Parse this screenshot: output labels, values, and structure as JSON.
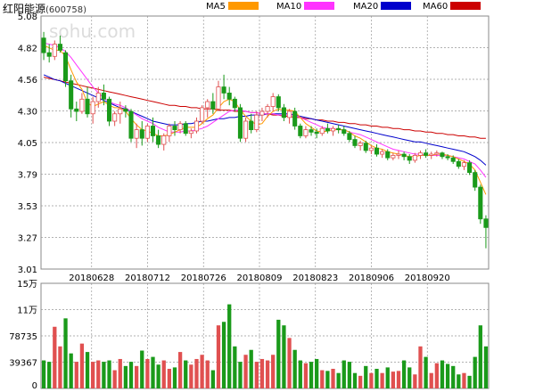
{
  "stock_name": "红阳能源",
  "stock_code": "(600758)",
  "watermark": "sohu.com",
  "legend": [
    {
      "label": "MA5",
      "color": "#ff9900"
    },
    {
      "label": "MA10",
      "color": "#ff33ff"
    },
    {
      "label": "MA20",
      "color": "#0000cc"
    },
    {
      "label": "MA60",
      "color": "#cc0000"
    }
  ],
  "colors": {
    "up": "#e05050",
    "down": "#1a9a1a",
    "grid": "#999999"
  },
  "chart_data": [
    {
      "type": "candlestick",
      "title": "",
      "ylim": [
        3.01,
        5.08
      ],
      "y_ticks": [
        "5.08",
        "4.82",
        "4.56",
        "4.30",
        "4.05",
        "3.79",
        "3.53",
        "3.27",
        "3.01"
      ],
      "x_tick_labels": [
        "20180628",
        "20180712",
        "20180726",
        "20180809",
        "20180823",
        "20180906",
        "20180920"
      ],
      "ohlc": [
        [
          4.9,
          4.95,
          4.72,
          4.78
        ],
        [
          4.78,
          4.85,
          4.7,
          4.75
        ],
        [
          4.75,
          4.88,
          4.72,
          4.85
        ],
        [
          4.85,
          4.92,
          4.78,
          4.8
        ],
        [
          4.78,
          4.8,
          4.5,
          4.55
        ],
        [
          4.55,
          4.6,
          4.25,
          4.32
        ],
        [
          4.32,
          4.38,
          4.22,
          4.3
        ],
        [
          4.3,
          4.45,
          4.28,
          4.4
        ],
        [
          4.4,
          4.5,
          4.25,
          4.28
        ],
        [
          4.28,
          4.42,
          4.2,
          4.38
        ],
        [
          4.38,
          4.5,
          4.33,
          4.45
        ],
        [
          4.45,
          4.52,
          4.35,
          4.4
        ],
        [
          4.4,
          4.42,
          4.18,
          4.22
        ],
        [
          4.22,
          4.3,
          4.18,
          4.28
        ],
        [
          4.28,
          4.38,
          4.2,
          4.32
        ],
        [
          4.32,
          4.35,
          4.25,
          4.3
        ],
        [
          4.3,
          4.32,
          4.05,
          4.08
        ],
        [
          4.08,
          4.2,
          4.0,
          4.15
        ],
        [
          4.15,
          4.22,
          4.02,
          4.08
        ],
        [
          4.08,
          4.2,
          4.05,
          4.18
        ],
        [
          4.18,
          4.25,
          4.05,
          4.1
        ],
        [
          4.1,
          4.15,
          4.0,
          4.03
        ],
        [
          4.03,
          4.12,
          3.98,
          4.1
        ],
        [
          4.1,
          4.2,
          4.05,
          4.18
        ],
        [
          4.18,
          4.22,
          4.1,
          4.15
        ],
        [
          4.15,
          4.22,
          4.12,
          4.2
        ],
        [
          4.2,
          4.22,
          4.1,
          4.12
        ],
        [
          4.12,
          4.16,
          4.08,
          4.14
        ],
        [
          4.14,
          4.25,
          4.12,
          4.22
        ],
        [
          4.22,
          4.35,
          4.2,
          4.33
        ],
        [
          4.33,
          4.4,
          4.25,
          4.38
        ],
        [
          4.38,
          4.45,
          4.28,
          4.32
        ],
        [
          4.32,
          4.55,
          4.3,
          4.5
        ],
        [
          4.5,
          4.6,
          4.4,
          4.45
        ],
        [
          4.45,
          4.5,
          4.35,
          4.4
        ],
        [
          4.4,
          4.42,
          4.3,
          4.33
        ],
        [
          4.33,
          4.36,
          4.05,
          4.08
        ],
        [
          4.08,
          4.25,
          4.05,
          4.22
        ],
        [
          4.22,
          4.28,
          4.12,
          4.15
        ],
        [
          4.15,
          4.3,
          4.13,
          4.27
        ],
        [
          4.27,
          4.33,
          4.22,
          4.3
        ],
        [
          4.3,
          4.36,
          4.25,
          4.34
        ],
        [
          4.34,
          4.45,
          4.3,
          4.42
        ],
        [
          4.42,
          4.44,
          4.3,
          4.33
        ],
        [
          4.33,
          4.36,
          4.22,
          4.25
        ],
        [
          4.25,
          4.32,
          4.2,
          4.3
        ],
        [
          4.3,
          4.33,
          4.15,
          4.18
        ],
        [
          4.18,
          4.2,
          4.08,
          4.1
        ],
        [
          4.1,
          4.18,
          4.08,
          4.15
        ],
        [
          4.15,
          4.18,
          4.1,
          4.13
        ],
        [
          4.13,
          4.16,
          4.08,
          4.12
        ],
        [
          4.12,
          4.18,
          4.1,
          4.16
        ],
        [
          4.16,
          4.2,
          4.12,
          4.14
        ],
        [
          4.14,
          4.18,
          4.1,
          4.16
        ],
        [
          4.16,
          4.19,
          4.12,
          4.15
        ],
        [
          4.15,
          4.18,
          4.1,
          4.12
        ],
        [
          4.12,
          4.14,
          4.05,
          4.07
        ],
        [
          4.07,
          4.1,
          4.0,
          4.02
        ],
        [
          4.02,
          4.06,
          3.98,
          4.04
        ],
        [
          4.04,
          4.06,
          3.96,
          3.98
        ],
        [
          3.98,
          4.02,
          3.95,
          4.0
        ],
        [
          4.0,
          4.03,
          3.93,
          3.95
        ],
        [
          3.95,
          3.99,
          3.92,
          3.97
        ],
        [
          3.97,
          3.99,
          3.9,
          3.92
        ],
        [
          3.92,
          3.96,
          3.9,
          3.94
        ],
        [
          3.94,
          3.98,
          3.91,
          3.95
        ],
        [
          3.95,
          3.97,
          3.9,
          3.93
        ],
        [
          3.93,
          3.95,
          3.87,
          3.9
        ],
        [
          3.9,
          3.96,
          3.88,
          3.94
        ],
        [
          3.94,
          3.98,
          3.91,
          3.96
        ],
        [
          3.96,
          3.99,
          3.92,
          3.94
        ],
        [
          3.94,
          3.97,
          3.91,
          3.95
        ],
        [
          3.95,
          3.98,
          3.93,
          3.96
        ],
        [
          3.96,
          3.97,
          3.91,
          3.93
        ],
        [
          3.93,
          3.95,
          3.9,
          3.92
        ],
        [
          3.92,
          3.94,
          3.87,
          3.89
        ],
        [
          3.89,
          3.91,
          3.83,
          3.85
        ],
        [
          3.85,
          3.9,
          3.82,
          3.88
        ],
        [
          3.88,
          3.9,
          3.78,
          3.8
        ],
        [
          3.8,
          3.82,
          3.65,
          3.68
        ],
        [
          3.68,
          3.7,
          3.38,
          3.42
        ],
        [
          3.42,
          3.45,
          3.18,
          3.35
        ]
      ],
      "ma5": [
        4.84,
        4.82,
        4.8,
        4.8,
        4.75,
        4.64,
        4.54,
        4.48,
        4.37,
        4.34,
        4.36,
        4.38,
        4.35,
        4.33,
        4.33,
        4.3,
        4.24,
        4.19,
        4.15,
        4.14,
        4.12,
        4.1,
        4.1,
        4.11,
        4.13,
        4.15,
        4.17,
        4.17,
        4.17,
        4.2,
        4.24,
        4.27,
        4.33,
        4.38,
        4.4,
        4.38,
        4.31,
        4.26,
        4.22,
        4.19,
        4.2,
        4.26,
        4.3,
        4.32,
        4.31,
        4.31,
        4.3,
        4.25,
        4.2,
        4.17,
        4.14,
        4.13,
        4.14,
        4.15,
        4.15,
        4.15,
        4.13,
        4.1,
        4.08,
        4.05,
        4.02,
        4.0,
        3.99,
        3.97,
        3.96,
        3.95,
        3.94,
        3.93,
        3.93,
        3.94,
        3.94,
        3.94,
        3.95,
        3.95,
        3.94,
        3.93,
        3.91,
        3.89,
        3.87,
        3.82,
        3.72,
        3.62
      ],
      "ma10": [
        4.86,
        4.85,
        4.84,
        4.82,
        4.79,
        4.74,
        4.68,
        4.62,
        4.56,
        4.5,
        4.45,
        4.41,
        4.38,
        4.36,
        4.35,
        4.33,
        4.3,
        4.27,
        4.24,
        4.22,
        4.2,
        4.17,
        4.15,
        4.13,
        4.13,
        4.13,
        4.14,
        4.14,
        4.15,
        4.16,
        4.18,
        4.21,
        4.24,
        4.27,
        4.3,
        4.31,
        4.31,
        4.3,
        4.29,
        4.29,
        4.28,
        4.28,
        4.28,
        4.27,
        4.27,
        4.27,
        4.27,
        4.25,
        4.23,
        4.21,
        4.19,
        4.17,
        4.16,
        4.16,
        4.15,
        4.15,
        4.13,
        4.12,
        4.11,
        4.09,
        4.07,
        4.05,
        4.03,
        4.01,
        3.99,
        3.98,
        3.97,
        3.96,
        3.95,
        3.95,
        3.94,
        3.94,
        3.94,
        3.94,
        3.94,
        3.93,
        3.92,
        3.91,
        3.89,
        3.87,
        3.82,
        3.76
      ],
      "ma20": [
        4.6,
        4.58,
        4.56,
        4.55,
        4.53,
        4.51,
        4.49,
        4.47,
        4.45,
        4.43,
        4.41,
        4.39,
        4.37,
        4.35,
        4.33,
        4.32,
        4.3,
        4.28,
        4.26,
        4.24,
        4.22,
        4.21,
        4.2,
        4.19,
        4.19,
        4.19,
        4.2,
        4.2,
        4.21,
        4.22,
        4.22,
        4.23,
        4.24,
        4.24,
        4.25,
        4.25,
        4.26,
        4.26,
        4.27,
        4.27,
        4.27,
        4.28,
        4.28,
        4.28,
        4.28,
        4.28,
        4.27,
        4.26,
        4.25,
        4.24,
        4.23,
        4.22,
        4.21,
        4.2,
        4.19,
        4.18,
        4.17,
        4.16,
        4.15,
        4.14,
        4.13,
        4.12,
        4.11,
        4.1,
        4.09,
        4.08,
        4.07,
        4.06,
        4.05,
        4.05,
        4.04,
        4.03,
        4.02,
        4.01,
        4.0,
        3.99,
        3.98,
        3.97,
        3.95,
        3.93,
        3.9,
        3.86
      ],
      "ma60": [
        4.58,
        4.57,
        4.56,
        4.55,
        4.54,
        4.53,
        4.52,
        4.51,
        4.5,
        4.49,
        4.48,
        4.47,
        4.46,
        4.45,
        4.44,
        4.43,
        4.42,
        4.41,
        4.4,
        4.39,
        4.38,
        4.37,
        4.36,
        4.35,
        4.35,
        4.34,
        4.34,
        4.33,
        4.33,
        4.32,
        4.32,
        4.32,
        4.31,
        4.31,
        4.31,
        4.3,
        4.3,
        4.3,
        4.29,
        4.29,
        4.28,
        4.28,
        4.27,
        4.27,
        4.26,
        4.26,
        4.25,
        4.25,
        4.24,
        4.24,
        4.23,
        4.23,
        4.22,
        4.22,
        4.21,
        4.21,
        4.2,
        4.2,
        4.19,
        4.19,
        4.18,
        4.18,
        4.17,
        4.17,
        4.16,
        4.16,
        4.15,
        4.15,
        4.14,
        4.14,
        4.13,
        4.13,
        4.12,
        4.12,
        4.11,
        4.11,
        4.1,
        4.1,
        4.09,
        4.09,
        4.08,
        4.08
      ]
    },
    {
      "type": "bar",
      "title": "",
      "y_ticks": [
        "15万",
        "11万",
        "78735",
        "39367",
        "0"
      ],
      "ylim": [
        0,
        150000
      ],
      "volume": [
        40000,
        38000,
        88000,
        60000,
        100000,
        50000,
        38000,
        64000,
        52000,
        38000,
        40000,
        38000,
        40000,
        26000,
        42000,
        32000,
        38000,
        32000,
        54000,
        42000,
        45000,
        34000,
        40000,
        28000,
        30000,
        52000,
        40000,
        34000,
        42000,
        48000,
        40000,
        26000,
        90000,
        95000,
        120000,
        60000,
        38000,
        48000,
        55000,
        38000,
        42000,
        40000,
        48000,
        98000,
        90000,
        72000,
        55000,
        40000,
        36000,
        38000,
        42000,
        26000,
        25000,
        28000,
        22000,
        40000,
        38000,
        22000,
        18000,
        32000,
        22000,
        28000,
        22000,
        30000,
        24000,
        25000,
        40000,
        30000,
        20000,
        60000,
        45000,
        22000,
        36000,
        40000,
        35000,
        32000,
        20000,
        22000,
        18000,
        45000,
        90000,
        60000
      ],
      "volume_up": [
        false,
        false,
        true,
        true,
        false,
        false,
        true,
        true,
        false,
        true,
        true,
        false,
        false,
        true,
        true,
        false,
        false,
        true,
        false,
        true,
        false,
        false,
        true,
        true,
        false,
        true,
        false,
        true,
        true,
        true,
        true,
        false,
        true,
        false,
        false,
        false,
        false,
        true,
        false,
        true,
        true,
        true,
        true,
        false,
        false,
        true,
        false,
        false,
        true,
        false,
        false,
        true,
        false,
        true,
        false,
        false,
        false,
        false,
        true,
        false,
        true,
        false,
        true,
        false,
        true,
        true,
        false,
        false,
        true,
        true,
        false,
        true,
        true,
        false,
        false,
        false,
        false,
        true,
        false,
        false,
        false,
        false
      ]
    }
  ]
}
